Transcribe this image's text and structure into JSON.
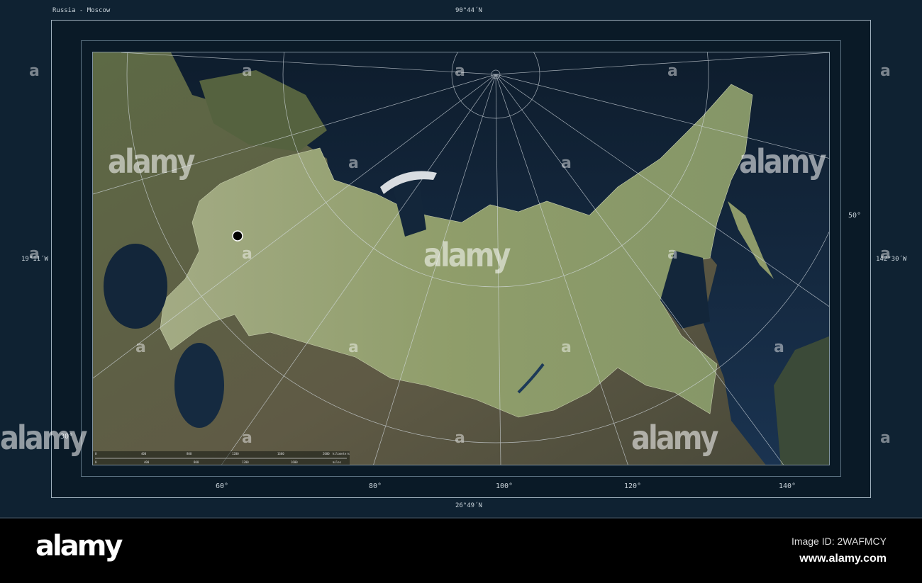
{
  "map": {
    "title": "Russia - Moscow",
    "top_label": "90°44´N",
    "bottom_label": "26°49´N",
    "left_label": "19°11´W",
    "right_label": "142°30´W",
    "longitude_ticks": [
      "60°",
      "80°",
      "100°",
      "120°",
      "140°"
    ],
    "latitude_ticks": {
      "right": "50°",
      "left": "30°"
    },
    "marker": {
      "name": "Moscow"
    },
    "scale_bar": {
      "top_labels": [
        "0",
        "400",
        "800",
        "1200",
        "1600",
        "2000"
      ],
      "top_unit": "kilometers",
      "bottom_labels": [
        "0",
        "400",
        "800",
        "1200",
        "1600"
      ],
      "bottom_unit": "miles"
    },
    "colors": {
      "frame": "#0f2232",
      "ocean": "#13263a",
      "land": "#8a9a6a",
      "highlight": "#a7b37f"
    }
  },
  "watermark": {
    "text": "alamy",
    "letter": "a"
  },
  "footer": {
    "logo": "alamy",
    "image_id": "Image ID: 2WAFMCY",
    "url": "www.alamy.com"
  }
}
